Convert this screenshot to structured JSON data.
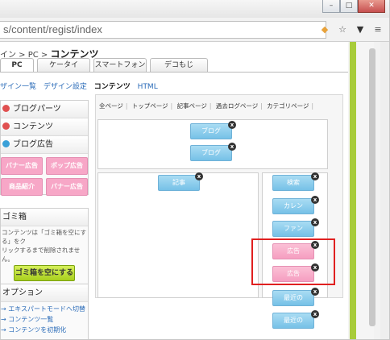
{
  "browser": {
    "url": "s/content/regist/index",
    "window_buttons": [
      "–",
      "□",
      "✕"
    ],
    "icons": [
      "shield-icon",
      "star-icon",
      "pocket-icon",
      "menu-icon"
    ]
  },
  "breadcrumb": {
    "prefix": "イン  >  PC  >",
    "current": "コンテンツ"
  },
  "tabs": [
    {
      "label": "PC"
    },
    {
      "label": "ケータイ"
    },
    {
      "label": "スマートフォン"
    },
    {
      "label": "デコもじ"
    }
  ],
  "subnav": [
    {
      "label": "ザイン一覧"
    },
    {
      "label": "デザイン設定"
    },
    {
      "label": "コンテンツ"
    },
    {
      "label": "HTML"
    }
  ],
  "sidebar": {
    "blog_parts": "ブログパーツ",
    "contents": "コンテンツ",
    "blog_ad": "ブログ広告",
    "ad_buttons": [
      {
        "label": "バナー広告"
      },
      {
        "label": "ポップ広告"
      },
      {
        "label": "商品紹介"
      },
      {
        "label": "バナー広告"
      }
    ],
    "trash_title": "ゴミ箱",
    "trash_text_1": "コンテンツは「ゴミ箱を空にする」をク",
    "trash_text_2": "リックするまで削除されません。",
    "trash_button": "ゴミ箱を空にする",
    "option_title": "オプション",
    "options": [
      {
        "label": "→ エキスパートモードへ切替"
      },
      {
        "label": "→ コンテンツ一覧"
      },
      {
        "label": "→ コンテンツを初期化"
      }
    ]
  },
  "main": {
    "page_tabs": [
      {
        "label": "全ページ"
      },
      {
        "label": "トップページ"
      },
      {
        "label": "記事ページ"
      },
      {
        "label": "過去ログページ"
      },
      {
        "label": "カテゴリページ"
      }
    ],
    "header_parts": [
      {
        "label": "ブログ"
      },
      {
        "label": "ブログ"
      }
    ],
    "center_parts": [
      {
        "label": "記事"
      }
    ],
    "side_parts": [
      {
        "label": "検索"
      },
      {
        "label": "カレン"
      },
      {
        "label": "ファン"
      },
      {
        "label": "広告"
      },
      {
        "label": "広告"
      },
      {
        "label": "最近の"
      },
      {
        "label": "最近の"
      }
    ]
  },
  "colors": {
    "part_blue": "#76c1e7",
    "part_pink": "#f59ec0",
    "highlight_red": "#e02020",
    "scroll_green": "#a8cc3a"
  }
}
